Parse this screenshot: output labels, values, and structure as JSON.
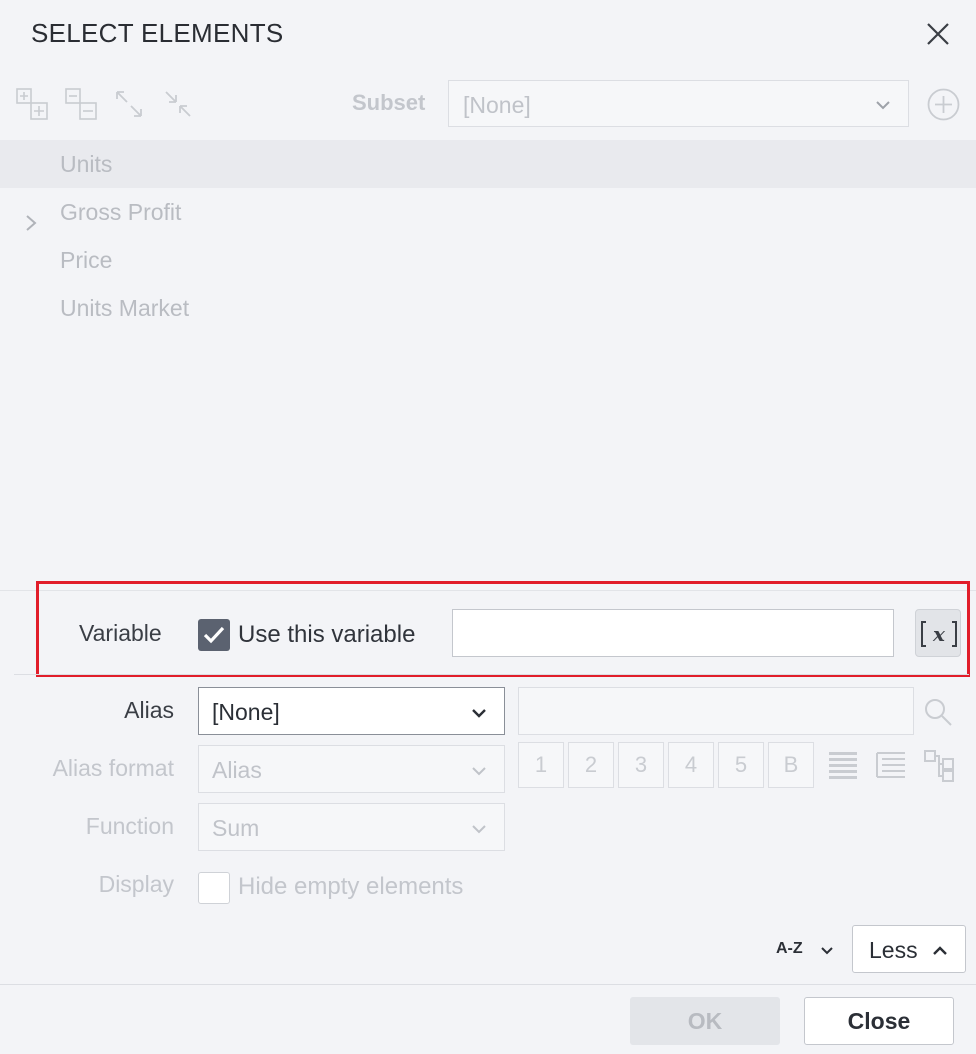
{
  "dialog": {
    "title": "SELECT ELEMENTS",
    "close_icon": "close-icon"
  },
  "toolbar": {
    "icons": [
      "expand-all-icon",
      "collapse-all-icon",
      "expand-arrows-icon",
      "collapse-arrows-icon"
    ],
    "subset_label": "Subset",
    "subset_value": "[None]",
    "add_icon": "plus-circle-icon"
  },
  "tree": {
    "items": [
      {
        "label": "Units",
        "selected": true,
        "expandable": false
      },
      {
        "label": "Gross Profit",
        "selected": false,
        "expandable": true
      },
      {
        "label": "Price",
        "selected": false,
        "expandable": false
      },
      {
        "label": "Units Market",
        "selected": false,
        "expandable": false
      }
    ]
  },
  "variable": {
    "label": "Variable",
    "checkbox_label": "Use this variable",
    "checked": true,
    "value": "",
    "fx_icon": "variable-x-icon"
  },
  "alias": {
    "label": "Alias",
    "value": "[None]",
    "search_value": ""
  },
  "alias_format": {
    "label": "Alias format",
    "value": "Alias",
    "buttons": [
      "1",
      "2",
      "3",
      "4",
      "5",
      "B"
    ],
    "icons": [
      "list-bold-icon",
      "list-indent-icon",
      "hierarchy-icon"
    ]
  },
  "function": {
    "label": "Function",
    "value": "Sum"
  },
  "display": {
    "label": "Display",
    "checkbox_label": "Hide empty elements",
    "checked": false
  },
  "sort": {
    "label": "A-Z"
  },
  "less_button": {
    "label": "Less"
  },
  "footer": {
    "ok_label": "OK",
    "close_label": "Close"
  },
  "colors": {
    "highlight_border": "#e11d2a",
    "checkbox_checked": "#5b6270",
    "disabled_text": "#c3c6cc"
  }
}
